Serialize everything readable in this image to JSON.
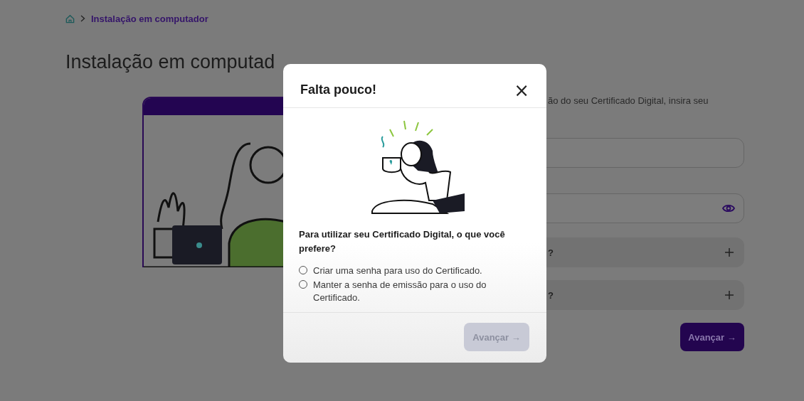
{
  "breadcrumb": {
    "current": "Instalação em computador"
  },
  "page_title": "Instalação em computad",
  "instructions": "ão do seu Certificado Digital, insira seu",
  "fields": [
    {
      "kind": "text"
    },
    {
      "kind": "password"
    }
  ],
  "accordions": [
    {
      "label": "?",
      "expanded": false
    },
    {
      "label": "?",
      "expanded": false
    }
  ],
  "submit_button": {
    "label": "Avançar →"
  },
  "modal": {
    "title": "Falta pouco!",
    "close": "×",
    "question": "Para utilizar seu Certificado Digital, o que você prefere?",
    "options": [
      {
        "label": "Criar uma senha para uso do Certificado.",
        "selected": false
      },
      {
        "label": "Manter a senha de emissão para o uso do Certificado.",
        "selected": false
      }
    ],
    "button": {
      "label": "Avançar →",
      "disabled": true
    }
  }
}
